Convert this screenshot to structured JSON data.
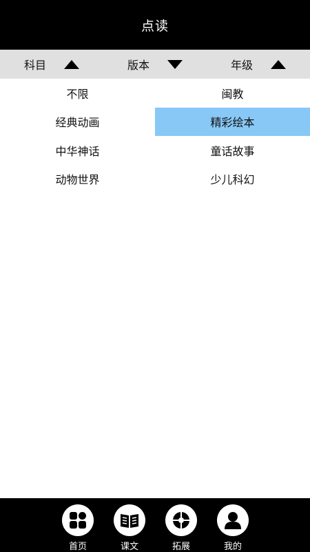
{
  "header": {
    "title": "点读"
  },
  "filters": [
    {
      "label": "科目",
      "arrow": "up"
    },
    {
      "label": "版本",
      "arrow": "down"
    },
    {
      "label": "年级",
      "arrow": "up"
    }
  ],
  "options": [
    {
      "label": "不限",
      "selected": false
    },
    {
      "label": "闽教",
      "selected": false
    },
    {
      "label": "经典动画",
      "selected": false
    },
    {
      "label": "精彩绘本",
      "selected": true
    },
    {
      "label": "中华神话",
      "selected": false
    },
    {
      "label": "童话故事",
      "selected": false
    },
    {
      "label": "动物世界",
      "selected": false
    },
    {
      "label": "少儿科幻",
      "selected": false
    }
  ],
  "colors": {
    "header_bg": "#000000",
    "filter_bg": "#e0e0e0",
    "selected_bg": "#88c8f6",
    "nav_bg": "#000000"
  },
  "nav": [
    {
      "label": "首页",
      "icon": "grid-icon"
    },
    {
      "label": "课文",
      "icon": "book-icon"
    },
    {
      "label": "拓展",
      "icon": "ball-icon"
    },
    {
      "label": "我的",
      "icon": "user-icon"
    }
  ]
}
